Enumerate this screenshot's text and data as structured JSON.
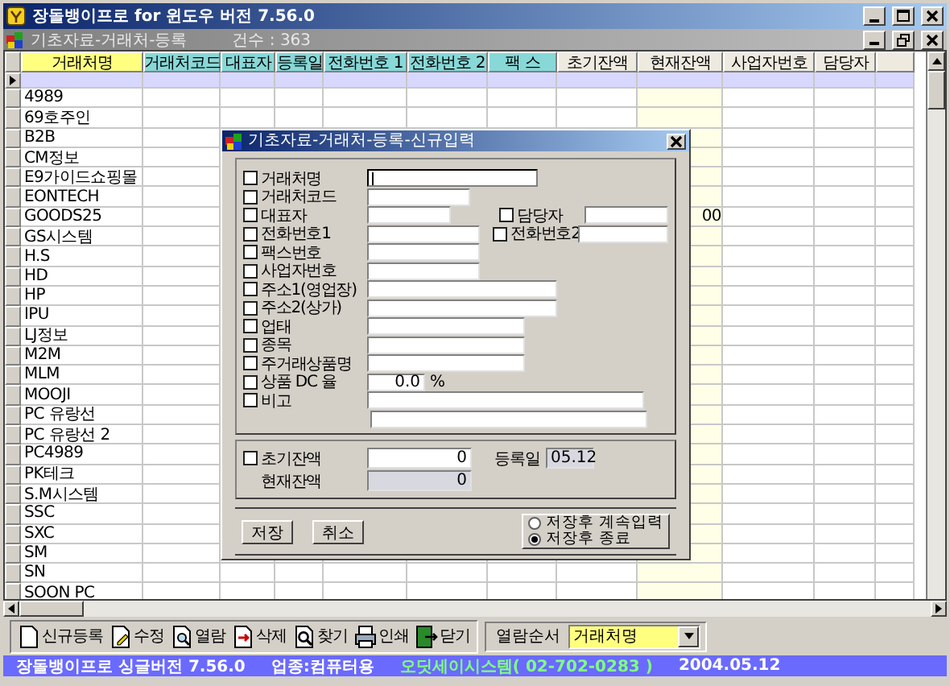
{
  "window": {
    "title": "장돌뱅이프로 for 윈도우 버전 7.56.0"
  },
  "child_window": {
    "title": "기초자료-거래처-등록",
    "count": "건수 : 363"
  },
  "table": {
    "columns": [
      {
        "label": "거래처명",
        "kind": "key",
        "highlighted": false
      },
      {
        "label": "거래처코드",
        "kind": "indexed",
        "highlighted": false
      },
      {
        "label": "대표자",
        "kind": "indexed",
        "highlighted": false
      },
      {
        "label": "등록일",
        "kind": "indexed",
        "highlighted": false
      },
      {
        "label": "전화번호 1",
        "kind": "indexed",
        "highlighted": false
      },
      {
        "label": "전화번호 2",
        "kind": "indexed",
        "highlighted": false
      },
      {
        "label": "팩 스",
        "kind": "indexed",
        "highlighted": false
      },
      {
        "label": "초기잔액",
        "kind": "plain",
        "highlighted": false
      },
      {
        "label": "현재잔액",
        "kind": "plain",
        "highlighted": true
      },
      {
        "label": "사업자번호",
        "kind": "plain",
        "highlighted": false
      },
      {
        "label": "담당자",
        "kind": "plain",
        "highlighted": false
      },
      {
        "kind": "plain",
        "highlighted": false
      }
    ],
    "rows": [
      {
        "selected": true
      },
      {
        "name": "4989",
        "selected": false
      },
      {
        "name": "69호주인",
        "selected": false
      },
      {
        "name": "B2B",
        "selected": false
      },
      {
        "name": "CM정보",
        "selected": false
      },
      {
        "name": "E9가이드쇼핑몰",
        "selected": false
      },
      {
        "name": "EONTECH",
        "selected": false
      },
      {
        "name": "GOODS25",
        "selected": false,
        "balance": "00"
      },
      {
        "name": "GS시스템",
        "selected": false
      },
      {
        "name": "H.S",
        "selected": false
      },
      {
        "name": "HD",
        "selected": false
      },
      {
        "name": "HP",
        "selected": false
      },
      {
        "name": "IPU",
        "selected": false
      },
      {
        "name": "LJ정보",
        "selected": false
      },
      {
        "name": "M2M",
        "selected": false
      },
      {
        "name": "MLM",
        "selected": false
      },
      {
        "name": "MOOJI",
        "selected": false
      },
      {
        "name": "PC 유랑선",
        "selected": false
      },
      {
        "name": "PC 유랑선 2",
        "selected": false
      },
      {
        "name": "PC4989",
        "selected": false
      },
      {
        "name": "PK테크",
        "selected": false
      },
      {
        "name": "S.M시스템",
        "selected": false
      },
      {
        "name": "SSC",
        "selected": false
      },
      {
        "name": "SXC",
        "selected": false
      },
      {
        "name": "SM",
        "selected": false
      },
      {
        "name": "SN",
        "selected": false
      },
      {
        "name": "SOON PC",
        "selected": false
      }
    ]
  },
  "dialog": {
    "title": "기초자료-거래처-등록-신규입력",
    "fields": [
      {
        "label": "거래처명",
        "checked": false,
        "focused": true
      },
      {
        "label": "거래처코드",
        "checked": false,
        "focused": false
      },
      {
        "label": "대표자",
        "checked": false,
        "focused": false,
        "side": {
          "label": "담당자",
          "checked": false
        }
      },
      {
        "label": "전화번호1",
        "checked": false,
        "focused": false,
        "side": {
          "label": "전화번호2",
          "checked": false
        }
      },
      {
        "label": "팩스번호",
        "checked": false,
        "focused": false
      },
      {
        "label": "사업자번호",
        "checked": false,
        "focused": false
      },
      {
        "label": "주소1(영업장)",
        "checked": false,
        "focused": false
      },
      {
        "label": "주소2(상가)",
        "checked": false,
        "focused": false
      },
      {
        "label": "업태",
        "checked": false,
        "focused": false
      },
      {
        "label": "종목",
        "checked": false,
        "focused": false
      },
      {
        "label": "주거래상품명",
        "checked": false,
        "focused": false
      },
      {
        "label": "상품 DC 율",
        "checked": false,
        "focused": false,
        "value": "0.0",
        "unit": "%"
      },
      {
        "label": "비고",
        "checked": false,
        "focused": false,
        "kind": "memo"
      }
    ],
    "opening_balance": {
      "label": "초기잔액",
      "checked": false,
      "value": "0"
    },
    "current_balance": {
      "label": "현재잔액",
      "value": "0"
    },
    "registered": {
      "label": "등록일",
      "value": "05.12"
    },
    "buttons": [
      "저장",
      "취소"
    ],
    "options": [
      {
        "label": "저장후 계속입력",
        "selected": false
      },
      {
        "label": "저장후 종료",
        "selected": true
      }
    ]
  },
  "toolbar": {
    "buttons": [
      {
        "label": "신규등록",
        "kind": "new"
      },
      {
        "label": "수정",
        "kind": "edit"
      },
      {
        "label": "열람",
        "kind": "view"
      },
      {
        "label": "삭제",
        "kind": "delete"
      },
      {
        "label": "찾기",
        "kind": "find"
      },
      {
        "label": "인쇄",
        "kind": "print"
      },
      {
        "label": "닫기",
        "kind": "close"
      }
    ],
    "sort": {
      "label": "열람순서",
      "value": "거래처명"
    }
  },
  "status_bar": [
    {
      "text": "장돌뱅이프로 싱글버전 7.56.0",
      "kind": "plain"
    },
    {
      "text": "업종:컴퓨터용",
      "kind": "plain"
    },
    {
      "text": "오딧세이시스템( 02-702-0283 )",
      "kind": "vendor"
    },
    {
      "text": "2004.05.12",
      "kind": "plain"
    }
  ]
}
